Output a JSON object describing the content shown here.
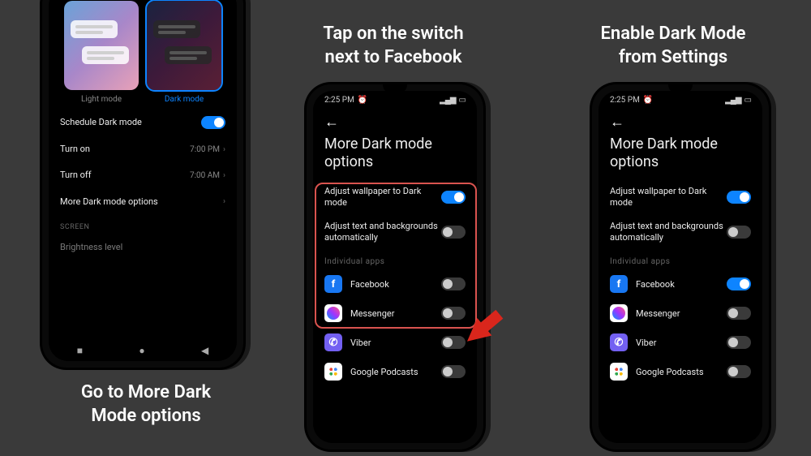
{
  "captions": {
    "c1_l1": "Go to More Dark",
    "c1_l2": "Mode options",
    "c2_l1": "Tap on the switch",
    "c2_l2": "next to Facebook",
    "c3_l1": "Enable Dark Mode",
    "c3_l2": "from Settings"
  },
  "status": {
    "time": "2:25 PM",
    "alarm_glyph": "⏰"
  },
  "phone1": {
    "light_label": "Light mode",
    "dark_label": "Dark mode",
    "schedule": "Schedule Dark mode",
    "turn_on": "Turn on",
    "turn_on_val": "7:00 PM",
    "turn_off": "Turn off",
    "turn_off_val": "7:00 AM",
    "more_options": "More Dark mode options",
    "screen_header": "SCREEN",
    "brightness": "Brightness level"
  },
  "phone23": {
    "title": "More Dark mode options",
    "adjust_wallpaper": "Adjust wallpaper to Dark mode",
    "adjust_text": "Adjust text and backgrounds automatically",
    "individual_apps": "Individual apps",
    "apps": {
      "fb": "Facebook",
      "msg": "Messenger",
      "viber": "Viber",
      "podcast": "Google Podcasts"
    }
  }
}
